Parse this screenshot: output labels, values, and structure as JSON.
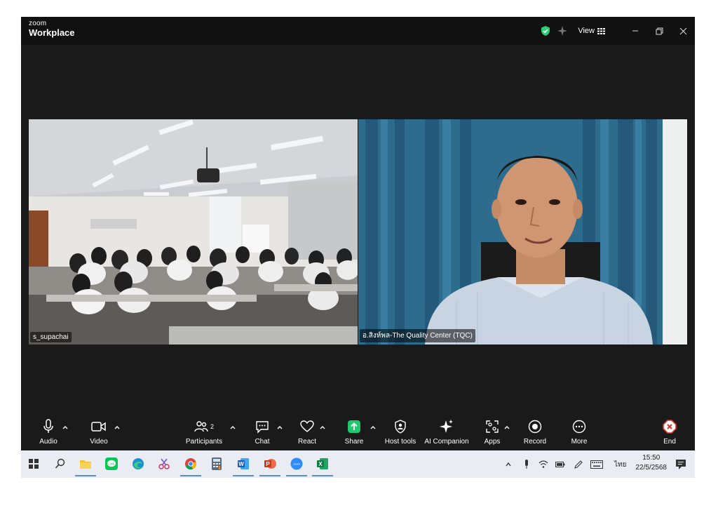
{
  "window": {
    "logo_top": "zoom",
    "logo_bottom": "Workplace",
    "view_label": "View"
  },
  "tiles": [
    {
      "name": "s_supachai",
      "scene": "classroom"
    },
    {
      "name": "อ.สิงห์พล-The Quality Center (TQC)",
      "scene": "presenter"
    }
  ],
  "toolbar": {
    "audio": "Audio",
    "video": "Video",
    "participants": "Participants",
    "participants_count": "2",
    "chat": "Chat",
    "react": "React",
    "share": "Share",
    "host_tools": "Host tools",
    "ai_companion": "AI Companion",
    "apps": "Apps",
    "record": "Record",
    "more": "More",
    "end": "End"
  },
  "taskbar": {
    "apps": [
      "windows-start",
      "search",
      "file-explorer",
      "line",
      "edge",
      "snipping",
      "chrome",
      "calculator",
      "word",
      "powerpoint",
      "zoom",
      "excel"
    ],
    "lang": "ไทย",
    "time": "15:50",
    "date": "22/5/2568"
  },
  "colors": {
    "window_bg": "#1a1a1a",
    "share_green": "#1ec86e",
    "end_red": "#e0302b",
    "shield_green": "#2ecc71",
    "taskbar_bg": "#e9ecf2"
  }
}
